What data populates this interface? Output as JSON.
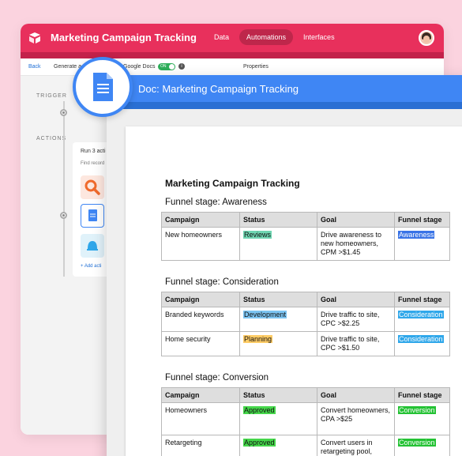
{
  "app": {
    "title": "Marketing Campaign Tracking",
    "nav": [
      "Data",
      "Automations",
      "Interfaces"
    ],
    "active_nav": "Automations",
    "brand_color": "#e8305c"
  },
  "subbar": {
    "back": "Back",
    "generate": "Generate a",
    "gdocs": "Google Docs",
    "toggle": "ON",
    "info": "i",
    "properties": "Properties"
  },
  "sidebar": {
    "trigger_label": "TRIGGER",
    "actions_label": "ACTIONS",
    "run_title": "Run 3 acti",
    "find_records": "Find record",
    "add_action": "+ Add acti",
    "action_icons": [
      "search-icon",
      "google-docs-icon",
      "slack-bell-icon"
    ]
  },
  "doc": {
    "header_title": "Doc: Marketing Campaign Tracking",
    "page_title": "Marketing Campaign Tracking",
    "columns": [
      "Campaign",
      "Status",
      "Goal",
      "Funnel stage"
    ],
    "sections": [
      {
        "title": "Funnel stage: Awareness",
        "rows": [
          {
            "campaign": "New homeowners",
            "status": "Reviews",
            "status_color": "#6fd6b2",
            "goal": "Drive awareness to new homeowners, CPM >$1.45",
            "stage": "Awareness",
            "stage_color": "#3973e6"
          }
        ]
      },
      {
        "title": "Funnel stage: Consideration",
        "rows": [
          {
            "campaign": "Branded keywords",
            "status": "Development",
            "status_color": "#7cc4f2",
            "goal": "Drive traffic to site, CPC >$2.25",
            "stage": "Consideration",
            "stage_color": "#2fa7ea"
          },
          {
            "campaign": "Home security",
            "status": "Planning",
            "status_color": "#ffcc66",
            "goal": "Drive traffic to site, CPC >$1.50",
            "stage": "Consideration",
            "stage_color": "#2fa7ea"
          }
        ]
      },
      {
        "title": "Funnel stage: Conversion",
        "rows": [
          {
            "campaign": "Homeowners",
            "status": "Approved",
            "status_color": "#45d64a",
            "goal": "Convert homeowners, CPA >$25",
            "stage": "Conversion",
            "stage_color": "#24c234"
          },
          {
            "campaign": "Retargeting",
            "status": "Approved",
            "status_color": "#45d64a",
            "goal": "Convert users in retargeting pool,",
            "stage": "Conversion",
            "stage_color": "#24c234"
          }
        ]
      }
    ]
  }
}
